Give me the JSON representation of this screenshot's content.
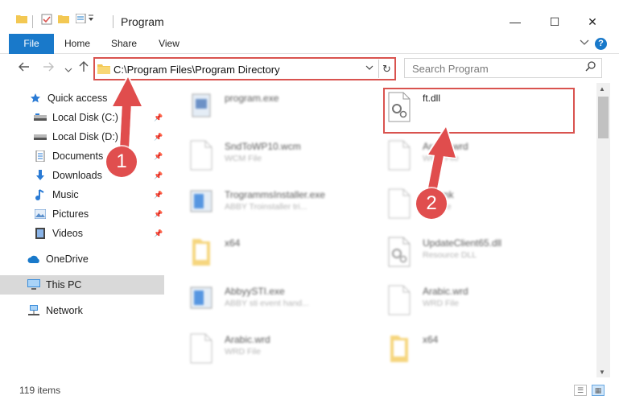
{
  "window": {
    "title": "Program",
    "minimize": "—",
    "maximize": "☐",
    "close": "✕"
  },
  "ribbon": {
    "tabs": [
      "File",
      "Home",
      "Share",
      "View"
    ],
    "help": "?"
  },
  "address": {
    "path": "C:\\Program Files\\Program Directory",
    "chevron": "⌄",
    "refresh": "↻"
  },
  "search": {
    "placeholder": "Search Program",
    "icon": "⌕"
  },
  "sidebar": {
    "items": [
      {
        "label": "Quick access",
        "icon": "star-icon"
      },
      {
        "label": "Local Disk (C:)",
        "icon": "drive-icon"
      },
      {
        "label": "Local Disk (D:)",
        "icon": "drive-icon"
      },
      {
        "label": "Documents",
        "icon": "documents-icon"
      },
      {
        "label": "Downloads",
        "icon": "download-icon"
      },
      {
        "label": "Music",
        "icon": "music-icon"
      },
      {
        "label": "Pictures",
        "icon": "pictures-icon"
      },
      {
        "label": "Videos",
        "icon": "videos-icon"
      },
      {
        "label": "OneDrive",
        "icon": "cloud-icon"
      },
      {
        "label": "This PC",
        "icon": "computer-icon"
      },
      {
        "label": "Network",
        "icon": "network-icon"
      }
    ]
  },
  "files": {
    "left": [
      {
        "name": "program.exe",
        "sub": ""
      },
      {
        "name": "SndToWP10.wcm",
        "sub": "WCM File"
      },
      {
        "name": "TrogrammsInstaller.exe",
        "sub": "ABBY Troinstaller tri..."
      },
      {
        "name": "x64",
        "sub": ""
      },
      {
        "name": "AbbyySTI.exe",
        "sub": "ABBY sti event hand..."
      },
      {
        "name": "Arabic.wrd",
        "sub": "WRD File"
      }
    ],
    "right": [
      {
        "name": "ft.dll",
        "sub": ""
      },
      {
        "name": "Arabic.wrd",
        "sub": "WRD File"
      },
      {
        "name": "x64.mk",
        "sub": "MK File"
      },
      {
        "name": "UpdateClient65.dll",
        "sub": "Resource DLL"
      },
      {
        "name": "Arabic.wrd",
        "sub": "WRD File"
      },
      {
        "name": "x64",
        "sub": ""
      }
    ]
  },
  "status": {
    "items": "119 items"
  },
  "annotations": {
    "badge1": "1",
    "badge2": "2"
  },
  "colors": {
    "accent": "#1979ca",
    "highlight": "#d9534f",
    "annotation": "#e04e4e"
  }
}
